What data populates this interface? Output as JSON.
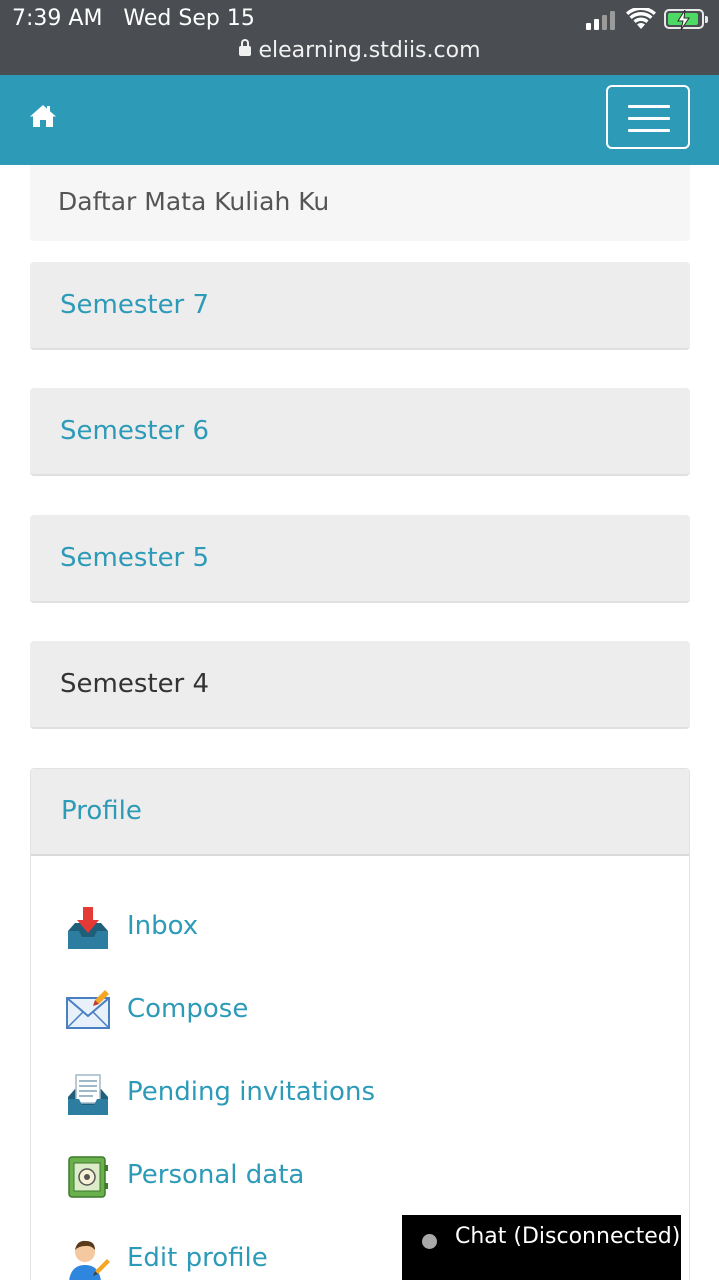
{
  "status_bar": {
    "time": "7:39 AM",
    "date": "Wed Sep 15",
    "url": "elearning.stdiis.com"
  },
  "navbar": {
    "home_icon": "home-icon",
    "menu_icon": "hamburger-menu-icon",
    "background": "#2d9bb8"
  },
  "breadcrumb": {
    "label": "Daftar Mata Kuliah Ku"
  },
  "semesters": [
    {
      "label": "Semester 7"
    },
    {
      "label": "Semester 6"
    },
    {
      "label": "Semester 5"
    },
    {
      "label": "Semester 4"
    }
  ],
  "profile": {
    "title": "Profile",
    "items": [
      {
        "label": "Inbox",
        "icon": "inbox-icon"
      },
      {
        "label": "Compose",
        "icon": "envelope-icon"
      },
      {
        "label": "Pending invitations",
        "icon": "pending-invitations-icon"
      },
      {
        "label": "Personal data",
        "icon": "safe-icon"
      },
      {
        "label": "Edit profile",
        "icon": "user-edit-icon"
      }
    ]
  },
  "chat": {
    "label": "Chat (Disconnected)"
  },
  "colors": {
    "accent": "#2d9bb8",
    "card_bg": "#ededed",
    "status_bar_bg": "#4a4d52",
    "battery": "#4cd964"
  }
}
